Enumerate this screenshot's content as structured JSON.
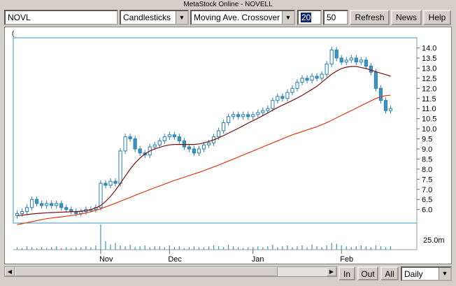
{
  "window": {
    "title": "MetaStock Online - NOVELL"
  },
  "toolbar": {
    "symbol": "NOVL",
    "chart_type": "Candlesticks",
    "study": "Moving Ave. Crossover",
    "period1": "20",
    "period2": "50",
    "refresh_label": "Refresh",
    "news_label": "News",
    "help_label": "Help"
  },
  "chart": {
    "corner_label": "("
  },
  "bottom": {
    "zoom_in_label": "In",
    "zoom_out_label": "Out",
    "all_label": "All",
    "interval": "Daily"
  },
  "colors": {
    "up": "#ffffff",
    "down": "#3a94c4",
    "candle_outline": "#2a7fb0",
    "ma_short": "#7a1010",
    "ma_long": "#e03a10",
    "volume": "#3a94c4"
  },
  "chart_data": {
    "type": "candlestick",
    "price_ticks": [
      "6.0",
      "6.5",
      "7.0",
      "7.5",
      "8.0",
      "8.5",
      "9.0",
      "9.5",
      "10.0",
      "10.5",
      "11.0",
      "11.5",
      "12.0",
      "12.5",
      "13.0",
      "13.5",
      "14.0"
    ],
    "volume_tick": "25.0m",
    "month_labels": [
      "Nov",
      "Dec",
      "Jan",
      "Feb"
    ],
    "ylim": [
      5.4,
      14.4
    ],
    "closes": [
      5.8,
      5.9,
      6.1,
      6.5,
      6.3,
      6.2,
      6.3,
      6.2,
      6.3,
      6.1,
      6.0,
      5.9,
      5.8,
      5.9,
      6.0,
      6.0,
      6.1,
      7.3,
      7.2,
      7.4,
      7.3,
      8.9,
      9.6,
      9.5,
      9.0,
      8.8,
      8.7,
      9.1,
      9.2,
      9.4,
      9.6,
      9.7,
      9.6,
      9.4,
      9.1,
      9.0,
      8.8,
      9.0,
      9.2,
      9.3,
      9.6,
      9.9,
      10.3,
      10.6,
      10.7,
      10.6,
      10.7,
      10.6,
      10.7,
      10.8,
      10.9,
      11.0,
      11.4,
      11.6,
      11.5,
      11.8,
      12.0,
      12.3,
      12.5,
      12.4,
      12.6,
      12.5,
      12.7,
      13.2,
      13.9,
      13.5,
      13.3,
      13.4,
      13.5,
      13.3,
      13.4,
      13.1,
      12.8,
      12.0,
      11.4,
      10.9,
      11.0
    ],
    "ma_short": [
      5.7,
      5.72,
      5.75,
      5.78,
      5.8,
      5.82,
      5.84,
      5.85,
      5.86,
      5.87,
      5.88,
      5.89,
      5.9,
      5.92,
      5.95,
      6.0,
      6.08,
      6.2,
      6.4,
      6.65,
      6.95,
      7.3,
      7.65,
      8.0,
      8.3,
      8.55,
      8.75,
      8.9,
      9.0,
      9.08,
      9.15,
      9.2,
      9.22,
      9.22,
      9.22,
      9.22,
      9.22,
      9.25,
      9.3,
      9.37,
      9.45,
      9.55,
      9.66,
      9.78,
      9.9,
      10.02,
      10.15,
      10.28,
      10.4,
      10.52,
      10.65,
      10.78,
      10.92,
      11.05,
      11.17,
      11.28,
      11.4,
      11.52,
      11.65,
      11.8,
      11.95,
      12.1,
      12.3,
      12.5,
      12.7,
      12.85,
      12.98,
      13.05,
      13.08,
      13.08,
      13.03,
      12.98,
      12.9,
      12.83,
      12.75,
      12.68,
      12.6
    ],
    "ma_long": [
      5.25,
      5.3,
      5.35,
      5.4,
      5.45,
      5.5,
      5.55,
      5.58,
      5.61,
      5.64,
      5.67,
      5.7,
      5.74,
      5.78,
      5.83,
      5.89,
      5.96,
      6.04,
      6.13,
      6.22,
      6.31,
      6.41,
      6.51,
      6.6,
      6.7,
      6.8,
      6.89,
      6.99,
      7.08,
      7.17,
      7.26,
      7.35,
      7.44,
      7.52,
      7.6,
      7.68,
      7.76,
      7.84,
      7.93,
      8.02,
      8.11,
      8.2,
      8.3,
      8.4,
      8.5,
      8.6,
      8.7,
      8.8,
      8.9,
      9.0,
      9.1,
      9.2,
      9.3,
      9.4,
      9.5,
      9.6,
      9.7,
      9.78,
      9.86,
      9.94,
      10.02,
      10.1,
      10.2,
      10.3,
      10.42,
      10.54,
      10.66,
      10.78,
      10.9,
      11.02,
      11.14,
      11.26,
      11.38,
      11.5,
      11.58,
      11.64,
      11.66
    ],
    "volumes": [
      3,
      2,
      4,
      3,
      2,
      3,
      2,
      3,
      4,
      2,
      3,
      2,
      3,
      3,
      4,
      3,
      5,
      30,
      10,
      6,
      8,
      5,
      4,
      6,
      3,
      4,
      5,
      3,
      4,
      4,
      3,
      5,
      3,
      4,
      2,
      3,
      4,
      3,
      3,
      4,
      5,
      4,
      3,
      6,
      4,
      3,
      2,
      3,
      3,
      4,
      3,
      4,
      6,
      3,
      4,
      5,
      3,
      4,
      5,
      3,
      6,
      4,
      3,
      5,
      8,
      7,
      5,
      4,
      3,
      4,
      5,
      4,
      3,
      5,
      4,
      3,
      4
    ]
  }
}
